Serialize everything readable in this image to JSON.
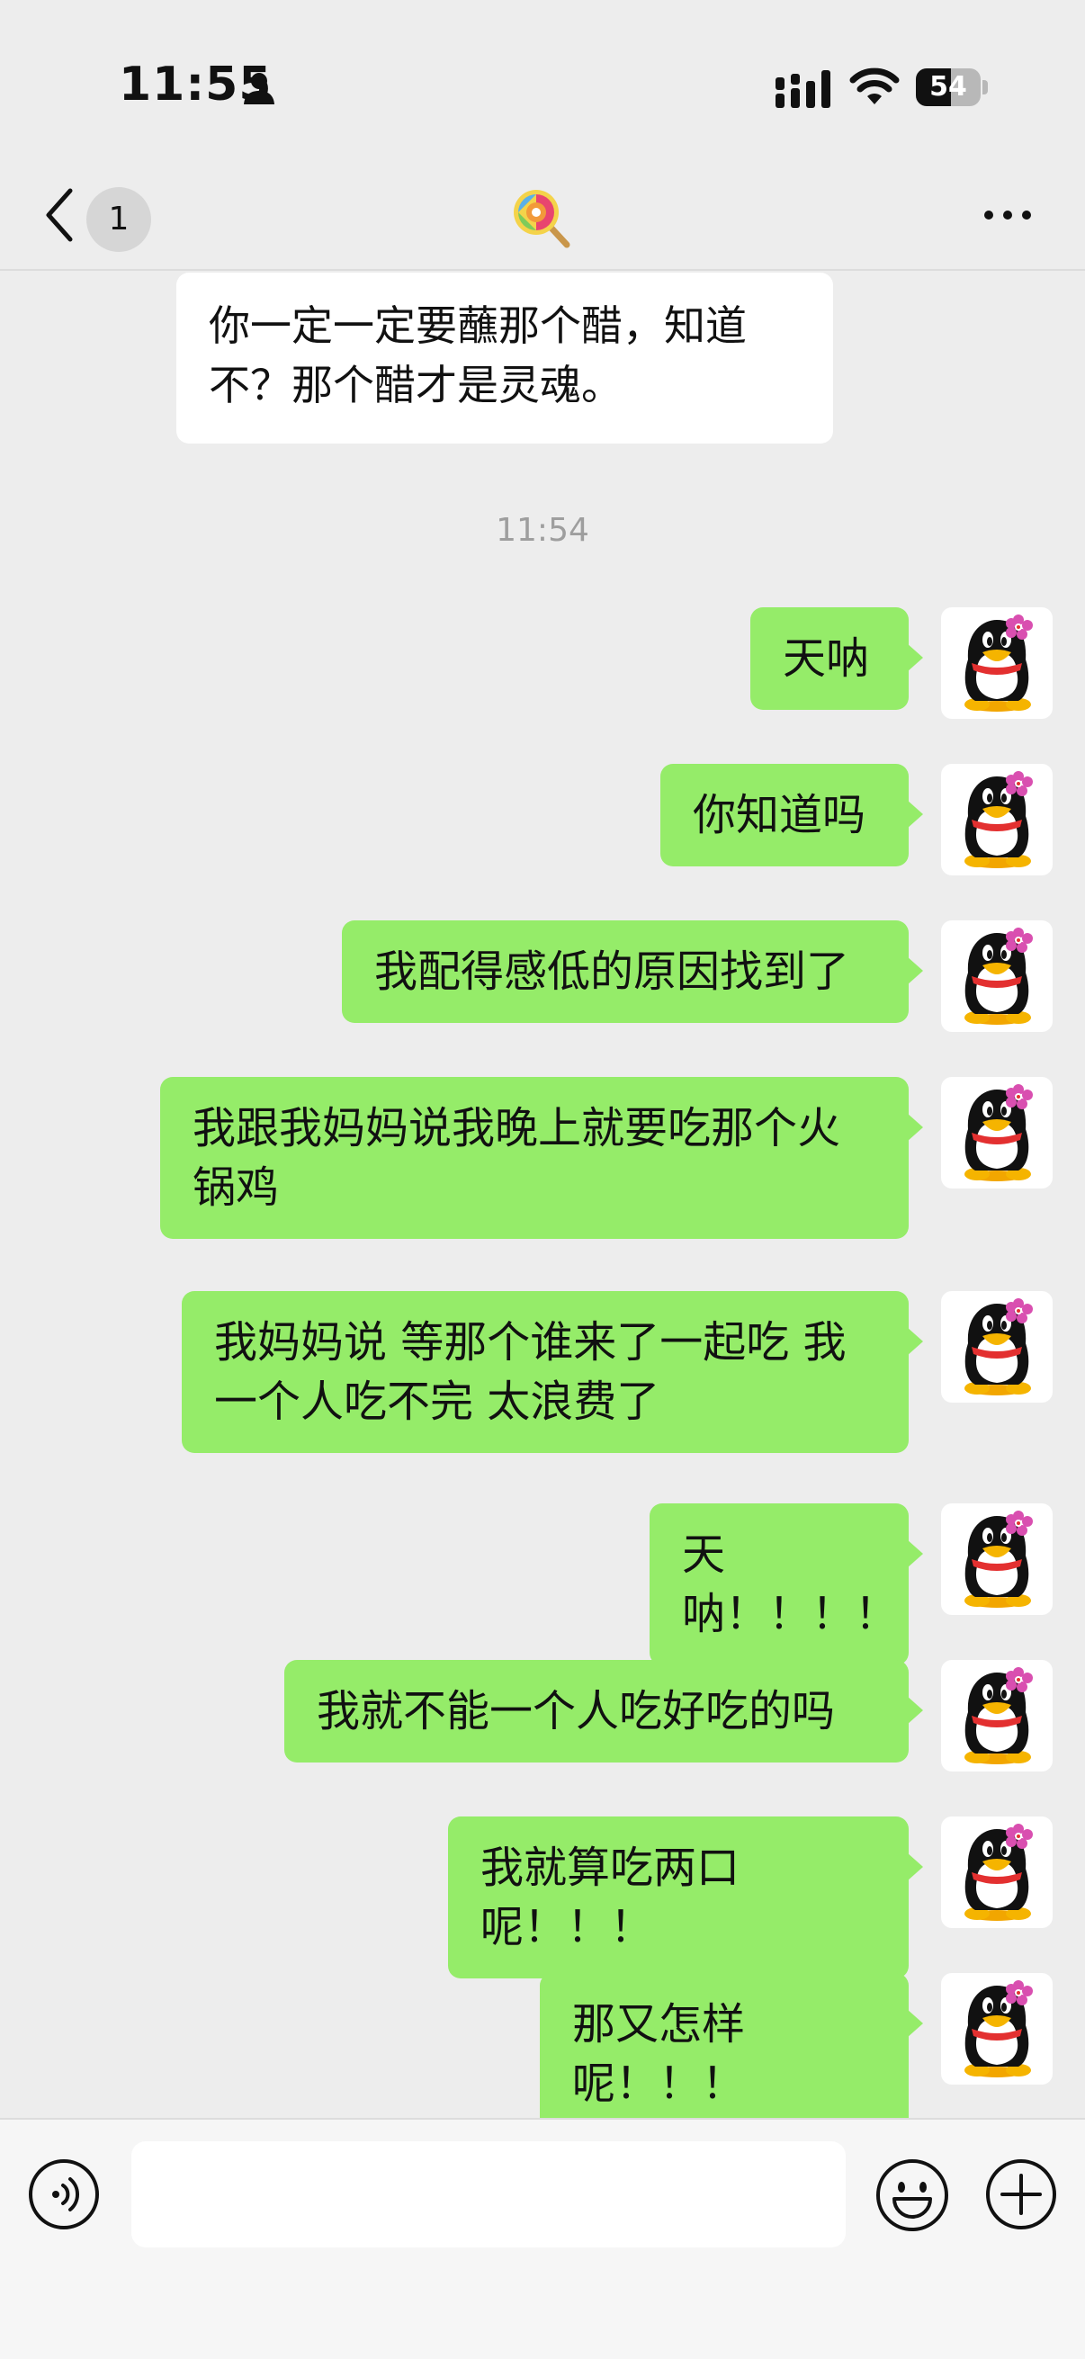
{
  "status_bar": {
    "time": "11:55",
    "battery": "54",
    "battery_level_percent": 54,
    "icons": [
      "person-icon",
      "signal-icon",
      "wifi-icon",
      "battery-icon"
    ]
  },
  "nav": {
    "back_badge": "1",
    "title_icon": "lollipop-icon",
    "more_icon": "more-icon"
  },
  "chat": {
    "incoming": [
      {
        "text": "你一定一定要蘸那个醋，知道不？那个醋才是灵魂。"
      }
    ],
    "timestamp": "11:54",
    "outgoing": [
      {
        "text": "天呐"
      },
      {
        "text": "你知道吗"
      },
      {
        "text": "我配得感低的原因找到了"
      },
      {
        "text": "我跟我妈妈说我晚上就要吃那个火锅鸡"
      },
      {
        "text": "我妈妈说 等那个谁来了一起吃 我一个人吃不完 太浪费了"
      },
      {
        "text": "天呐！！！！"
      },
      {
        "text": "我就不能一个人吃好吃的吗"
      },
      {
        "text": "我就算吃两口呢！！！"
      },
      {
        "text": "那又怎样呢！！！"
      }
    ],
    "colors": {
      "outgoing_bubble": "#95ec69",
      "incoming_bubble": "#ffffff",
      "background": "#ededed"
    }
  },
  "input_bar": {
    "text_value": "",
    "icons": [
      "voice-icon",
      "emoji-icon",
      "plus-icon"
    ]
  }
}
